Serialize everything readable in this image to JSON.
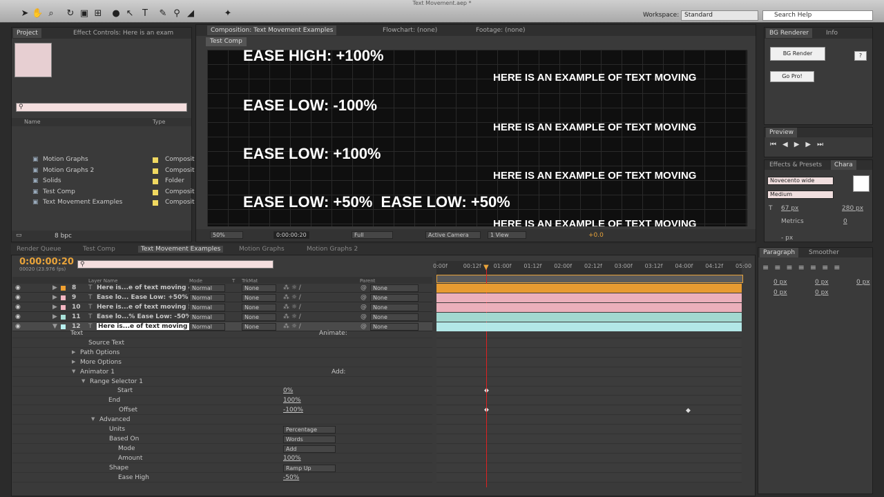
{
  "window": {
    "title": "Text Movement.aep *"
  },
  "toolbar": {
    "workspace_label": "Workspace:",
    "workspace_value": "Standard",
    "search_placeholder": "Search Help"
  },
  "project": {
    "tabs": [
      "Project",
      "Effect Controls: Here is an exam"
    ],
    "search": "",
    "columns": [
      "Name",
      "Type"
    ],
    "items": [
      {
        "name": "Motion Graphs",
        "type": "Composit"
      },
      {
        "name": "Motion Graphs 2",
        "type": "Composit"
      },
      {
        "name": "Solids",
        "type": "Folder"
      },
      {
        "name": "Test Comp",
        "type": "Composit"
      },
      {
        "name": "Text Movement Examples",
        "type": "Composit"
      }
    ],
    "bpc": "8 bpc"
  },
  "comp": {
    "tabs": [
      "Composition: Text Movement Examples",
      "Flowchart: (none)",
      "Footage: (none)"
    ],
    "subtab": "Test Comp",
    "lines": [
      "EASE HIGH: +100%",
      "HERE IS AN EXAMPLE OF TEXT MOVING",
      "EASE LOW: -100%",
      "HERE IS AN EXAMPLE OF TEXT MOVING",
      "EASE LOW: +100%",
      "HERE IS AN EXAMPLE OF TEXT MOVING",
      "EASE LOW: +50%  EASE LOW: +50%",
      "HERE IS AN EXAMPLE OF TEXT MOVING"
    ],
    "zoom": "50%",
    "time": "0:00:00:20",
    "resolution": "Full",
    "camera": "Active Camera",
    "view": "1 View",
    "exposure": "+0.0"
  },
  "right": {
    "tabs": [
      "BG Renderer",
      "Info"
    ],
    "bg_render": "BG Render",
    "go_pro": "Go Pro!",
    "help": "?",
    "preview_tab": "Preview",
    "effects_tab": "Effects & Presets",
    "chara_tab": "Chara",
    "font": "Novecento wide",
    "style": "Medium",
    "size": "67 px",
    "leading": "280 px",
    "kerning": "Metrics",
    "tracking": "0",
    "indent": "- px",
    "paragraph_tab": "Paragraph",
    "smoother_tab": "Smoother",
    "para_vals": [
      "0 px",
      "0 px",
      "0 px",
      "0 px",
      "0 px"
    ]
  },
  "timeline": {
    "tabs": [
      "Render Queue",
      "Test Comp",
      "Text Movement Examples",
      "Motion Graphs",
      "Motion Graphs 2"
    ],
    "time": "0:00:00:20",
    "fps": "00020 (23.976 fps)",
    "cols": [
      "Layer Name",
      "Mode",
      "T",
      "TrkMat",
      "Parent"
    ],
    "layers": [
      {
        "num": "8",
        "name": "Here is...e of text moving 4",
        "mode": "Normal",
        "trk": "None",
        "parent": "None",
        "color": "#f0a030"
      },
      {
        "num": "9",
        "name": "Ease lo...  Ease Low: +50%",
        "mode": "Normal",
        "trk": "None",
        "parent": "None",
        "color": "#f4b6c2"
      },
      {
        "num": "10",
        "name": "Here is...e of text moving 5",
        "mode": "Normal",
        "trk": "None",
        "parent": "None",
        "color": "#f4b6c2"
      },
      {
        "num": "11",
        "name": "Ease lo...%  Ease Low: -50%",
        "mode": "Normal",
        "trk": "None",
        "parent": "None",
        "color": "#a8e0d8"
      },
      {
        "num": "12",
        "name": "Here is...e of text moving 6",
        "mode": "Normal",
        "trk": "None",
        "parent": "None",
        "color": "#b8f0f0"
      }
    ],
    "ticks": [
      "0:00f",
      "00:12f",
      "01:00f",
      "01:12f",
      "02:00f",
      "02:12f",
      "03:00f",
      "03:12f",
      "04:00f",
      "04:12f",
      "05:00"
    ],
    "props": {
      "text": "Text",
      "animate": "Animate:",
      "source_text": "Source Text",
      "path_options": "Path Options",
      "more_options": "More Options",
      "animator": "Animator 1",
      "add": "Add:",
      "range": "Range Selector 1",
      "start": "Start",
      "start_v": "0%",
      "end": "End",
      "end_v": "100%",
      "offset": "Offset",
      "offset_v": "-100%",
      "advanced": "Advanced",
      "units": "Units",
      "units_v": "Percentage",
      "based_on": "Based On",
      "based_on_v": "Words",
      "mode": "Mode",
      "mode_v": "Add",
      "amount": "Amount",
      "amount_v": "100%",
      "shape": "Shape",
      "shape_v": "Ramp Up",
      "ease_high": "Ease High",
      "ease_high_v": "-50%"
    }
  }
}
